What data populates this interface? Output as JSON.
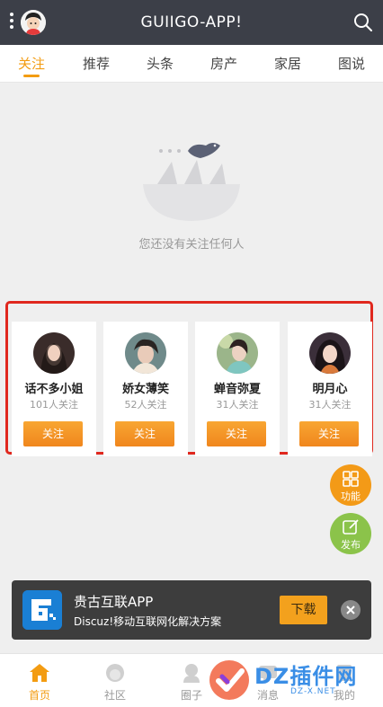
{
  "header": {
    "title": "GUIIGO-APP!"
  },
  "tabs": [
    "关注",
    "推荐",
    "头条",
    "房产",
    "家居",
    "图说"
  ],
  "empty": {
    "text": "您还没有关注任何人"
  },
  "recommend": [
    {
      "name": "话不多小姐",
      "count": "101人关注",
      "button": "关注"
    },
    {
      "name": "娇女薄笑",
      "count": "52人关注",
      "button": "关注"
    },
    {
      "name": "蝉音弥夏",
      "count": "31人关注",
      "button": "关注"
    },
    {
      "name": "明月心",
      "count": "31人关注",
      "button": "关注"
    }
  ],
  "fabs": {
    "func": "功能",
    "post": "发布"
  },
  "banner": {
    "app_name": "贵古互联APP",
    "desc": "Discuz!移动互联网化解决方案",
    "download": "下载"
  },
  "tabbar": [
    "首页",
    "社区",
    "圈子",
    "消息",
    "我的"
  ],
  "watermark": {
    "brand": "DZ插件网",
    "url": "DZ-X.NET"
  },
  "colors": {
    "accent": "#f39c12",
    "header": "#3c3f48",
    "highlight_box": "#e0281e"
  }
}
